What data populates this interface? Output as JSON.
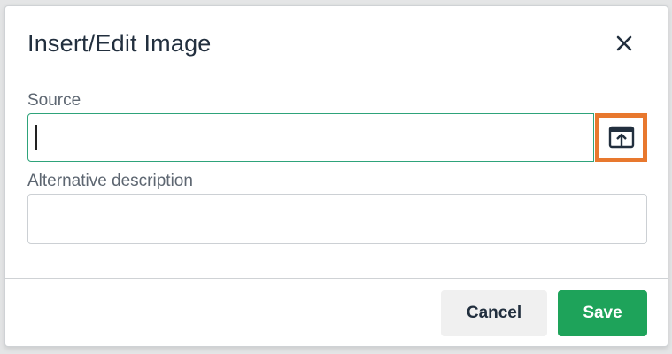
{
  "dialog": {
    "title": "Insert/Edit Image",
    "close_icon": "close-icon"
  },
  "fields": {
    "source": {
      "label": "Source",
      "value": "",
      "placeholder": "",
      "browse_icon": "upload-browse-icon"
    },
    "alt": {
      "label": "Alternative description",
      "value": "",
      "placeholder": ""
    }
  },
  "footer": {
    "cancel_label": "Cancel",
    "save_label": "Save"
  },
  "colors": {
    "accent_green": "#1ea35a",
    "focus_border": "#2ea37a",
    "highlight_orange": "#e8782e",
    "title_text": "#222f3e"
  }
}
